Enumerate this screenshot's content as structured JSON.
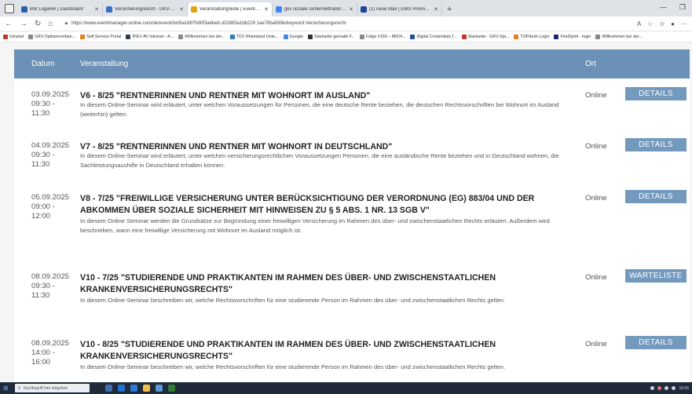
{
  "browser": {
    "tabs": [
      {
        "label": "BW LogaHR | Dashboard",
        "color": "#2b5fa8",
        "active": false
      },
      {
        "label": "Versicherungsrecht - GKV-Spitze",
        "color": "#3a6fc4",
        "active": false
      },
      {
        "label": "Veranstaltungsliste | EventManag",
        "color": "#e0a11b",
        "active": true
      },
      {
        "label": "gkv soziale sicherheitfrankreich",
        "color": "#4285f4",
        "active": false
      },
      {
        "label": "(1) neue Mail | GMX Premium",
        "color": "#1c449b",
        "active": false
      }
    ],
    "new_tab": "+",
    "url": "https://www.eventmanager-online.com/de/event/list/6a1897b90f3a4beb d32865a1bb229 1ae78ba569e/keyword:Versicherungsrecht",
    "bookmarks": [
      {
        "label": "Intranet",
        "color": "#c0392b"
      },
      {
        "label": "GKV-Spitzenverban...",
        "color": "#888888"
      },
      {
        "label": "Self Service Portal",
        "color": "#e67e22"
      },
      {
        "label": "IPEV AV Intranet - A...",
        "color": "#2c3e50"
      },
      {
        "label": "Willkommen bei der...",
        "color": "#888888"
      },
      {
        "label": "TÜV Rheinland Unte...",
        "color": "#2980b9"
      },
      {
        "label": "Google",
        "color": "#4285f4"
      },
      {
        "label": "Startseite gematik F...",
        "color": "#333333"
      },
      {
        "label": "Folge #150 – MIO4...",
        "color": "#888888"
      },
      {
        "label": "Digital Credentials f...",
        "color": "#1f4e9a"
      },
      {
        "label": "Startseite - GKV-Spi...",
        "color": "#c0392b"
      },
      {
        "label": "TOPdesk Login",
        "color": "#e67e22"
      },
      {
        "label": "FirstSpirit - login",
        "color": "#1a237e"
      },
      {
        "label": "Willkommen bei der...",
        "color": "#888888"
      }
    ]
  },
  "table": {
    "headers": {
      "datum": "Datum",
      "veranstaltung": "Veranstaltung",
      "ort": "Ort"
    },
    "rows": [
      {
        "date": "03.09.2025",
        "time_start": "09:30 -",
        "time_end": "11:30",
        "title": "V6 - 8/25 \"RENTNERINNEN UND RENTNER MIT WOHNORT IM AUSLAND\"",
        "description": "In diesem Online-Seminar wird erläutert, unter welchen Voraussetzungen für Personen, die eine deutsche Rente beziehen, die deutschen Rechtsvorschriften bei Wohnort im Ausland (weiterhin) gelten.",
        "ort": "Online",
        "button": "DETAILS"
      },
      {
        "date": "04.09.2025",
        "time_start": "09:30 -",
        "time_end": "11:30",
        "title": "V7 - 8/25 \"RENTNERINNEN UND RENTNER MIT WOHNORT IN DEUTSCHLAND\"",
        "description": "In diesem Online-Seminar wird erläutert, unter welchen versicherungsrechtlichen Voraussetzungen Personen, die eine ausländische Rente beziehen und in Deutschland wohnen, die Sachleistungsaushilfe in Deutschland erhalten können.",
        "ort": "Online",
        "button": "DETAILS"
      },
      {
        "date": "05.09.2025",
        "time_start": "09:00 -",
        "time_end": "12:00",
        "title": "V8 - 7/25 \"FREIWILLIGE VERSICHERUNG UNTER BERÜCKSICHTIGUNG DER VERORDNUNG (EG) 883/04 UND DER ABKOMMEN ÜBER SOZIALE SICHERHEIT MIT HINWEISEN ZU § 5 ABS. 1 NR. 13 SGB V\"",
        "description": "In diesem Online Seminar werden die Grundsätze zur Begründung einer freiwilligen Versicherung im Rahmen des über- und zwischenstaatlichen Rechts erläutert. Außerdem wird beschrieben, wann eine freiwillige Versicherung mit Wohnort im Ausland möglich ist.",
        "ort": "Online",
        "button": "DETAILS"
      },
      {
        "date": "08.09.2025",
        "time_start": "09:30 -",
        "time_end": "11:30",
        "title": "V10 - 7/25 \"STUDIERENDE UND PRAKTIKANTEN IM RAHMEN DES ÜBER- UND ZWISCHENSTAATLICHEN KRANKENVERSICHERUNGSRECHTS\"",
        "description": "In diesem Online-Seminar beschreiben wir, welche Rechtsvorschriften für eine studierende Person im Rahmen des über- und zwischenstaatlichen Rechts gelten.",
        "ort": "Online",
        "button": "WARTELISTE"
      },
      {
        "date": "08.09.2025",
        "time_start": "14:00 -",
        "time_end": "16:00",
        "title": "V10 - 8/25 \"STUDIERENDE UND PRAKTIKANTEN IM RAHMEN DES ÜBER- UND ZWISCHENSTAATLICHEN KRANKENVERSICHERUNGSRECHTS\"",
        "description": "In diesem Online-Seminar beschreiben wir, welche Rechtsvorschriften für eine studierende Person im Rahmen des über- und zwischenstaatlichen Rechts gelten.",
        "ort": "Online",
        "button": "DETAILS"
      }
    ]
  },
  "taskbar": {
    "search_placeholder": "Suchbegriff hier eingeben",
    "clock": "16:06"
  }
}
